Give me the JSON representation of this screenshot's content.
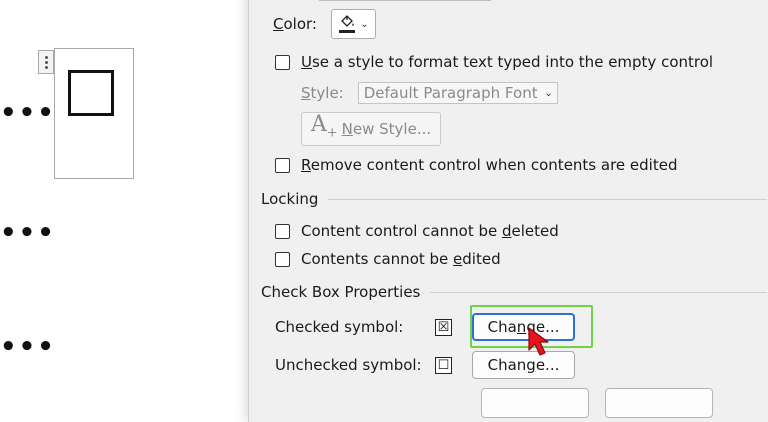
{
  "dialog": {
    "color_label": "Color:",
    "color_icon": "paint-bucket-icon",
    "use_style_label": "Use a style to format text typed into the empty control",
    "style_label": "Style:",
    "style_value": "Default Paragraph Font",
    "new_style_label": "New Style...",
    "remove_cc_label": "Remove content control when contents are edited",
    "locking": {
      "title": "Locking",
      "cannot_delete_label": "Content control cannot be deleted",
      "cannot_edit_label": "Contents cannot be edited"
    },
    "checkbox_props": {
      "title": "Check Box Properties",
      "checked_label": "Checked symbol:",
      "checked_symbol": "☒",
      "unchecked_label": "Unchecked symbol:",
      "unchecked_symbol": "☐",
      "change_label": "Change..."
    }
  },
  "colors": {
    "highlight": "#6fd24a",
    "focus": "#2a6fd6",
    "cursor": "#e8131b"
  }
}
